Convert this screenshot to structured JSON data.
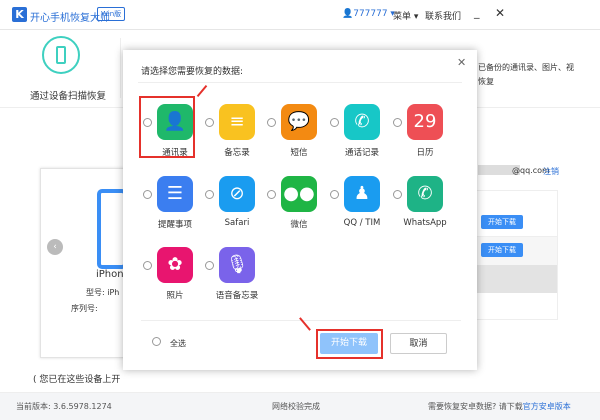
{
  "header": {
    "logo": "K",
    "title": "开心手机恢复大师",
    "edition": "Win版",
    "user": "777777 ▾",
    "menu": "菜单 ▾",
    "contact": "联系我们",
    "minimize": "_",
    "close": "✕"
  },
  "nav": {
    "item1": "通过设备扫描恢复",
    "item3_desc_1": "已备份的通讯录、图片、视",
    "item3_desc_2": "恢复"
  },
  "device": {
    "name": "iPhone",
    "model_label": "型号: iPh",
    "serial_label": "序列号:",
    "note": "( 您已在这些设备上开"
  },
  "account": {
    "email": "@qq.com",
    "logout": "注销",
    "download1": "开始下载",
    "download2": "开始下载"
  },
  "dialog": {
    "title": "请选择您需要恢复的数据:",
    "close": "✕",
    "items": [
      {
        "label": "通讯录",
        "icon": "contacts-icon",
        "color": "#1fb86a",
        "glyph": "👤"
      },
      {
        "label": "备忘录",
        "icon": "notes-icon",
        "color": "#f9c220",
        "glyph": "≡"
      },
      {
        "label": "短信",
        "icon": "messages-icon",
        "color": "#f38a12",
        "glyph": "💬"
      },
      {
        "label": "通话记录",
        "icon": "call-log-icon",
        "color": "#17c7c7",
        "glyph": "✆"
      },
      {
        "label": "日历",
        "icon": "calendar-icon",
        "color": "#ee4f55",
        "glyph": "29"
      },
      {
        "label": "提醒事项",
        "icon": "reminders-icon",
        "color": "#3b7ef0",
        "glyph": "☰"
      },
      {
        "label": "Safari",
        "icon": "safari-icon",
        "color": "#1a9cf0",
        "glyph": "⊘"
      },
      {
        "label": "微信",
        "icon": "wechat-icon",
        "color": "#1fb545",
        "glyph": "●●"
      },
      {
        "label": "QQ / TIM",
        "icon": "qq-icon",
        "color": "#1a9cf0",
        "glyph": "♟"
      },
      {
        "label": "WhatsApp",
        "icon": "whatsapp-icon",
        "color": "#1eb386",
        "glyph": "✆"
      },
      {
        "label": "照片",
        "icon": "photos-icon",
        "color": "#e8156f",
        "glyph": "✿"
      },
      {
        "label": "语音备忘录",
        "icon": "voice-memo-icon",
        "color": "#7a63ea",
        "glyph": "🎙"
      }
    ],
    "select_all": "全选",
    "start": "开始下载",
    "cancel": "取消"
  },
  "footer": {
    "version": "当前版本: 3.6.5978.1274",
    "status": "网络校验完成",
    "android_prompt": "需要恢复安卓数据? 请下载",
    "android_link": "官方安卓版本"
  }
}
